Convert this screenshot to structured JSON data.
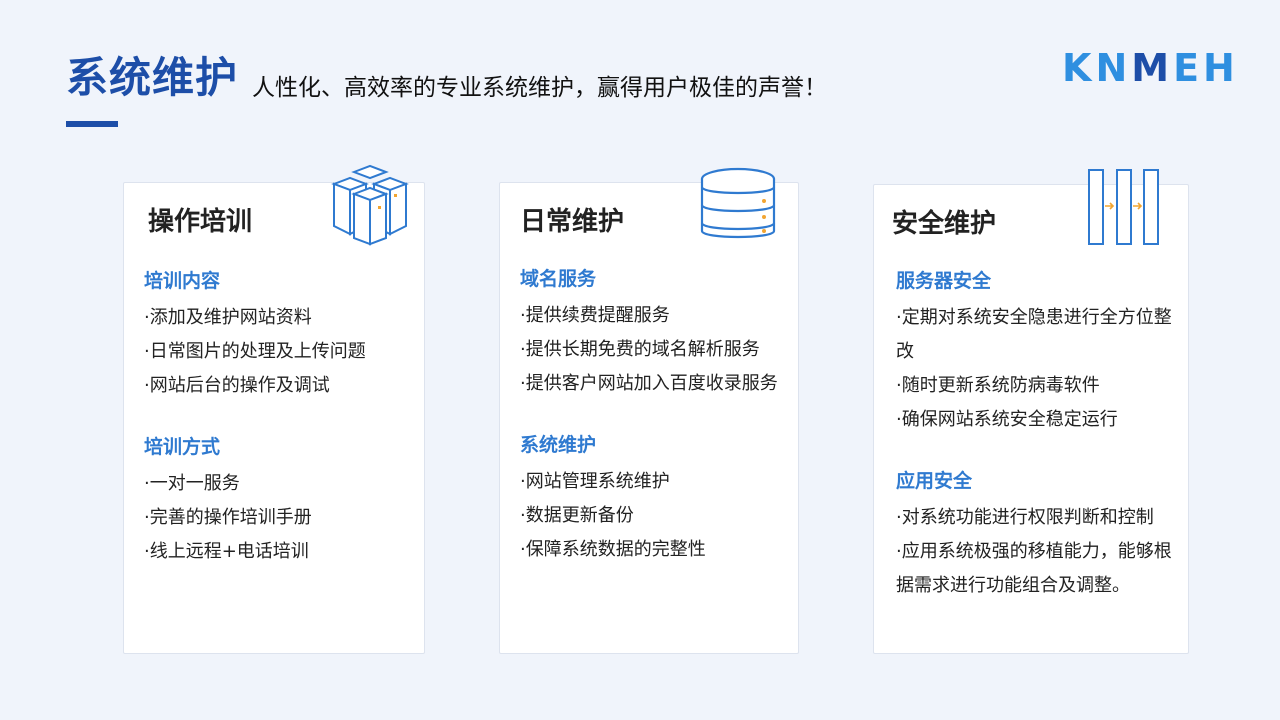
{
  "header": {
    "title": "系统维护",
    "subtitle": "人性化、高效率的专业系统维护，赢得用户极佳的声誉！",
    "logo": {
      "part1": "K",
      "part2": "N",
      "part3": "M",
      "part4": "EH"
    }
  },
  "cards": [
    {
      "title": "操作培训",
      "icon": "server-cluster-icon",
      "sections": [
        {
          "heading": "培训内容",
          "items": [
            "·添加及维护网站资料",
            "·日常图片的处理及上传问题",
            "·网站后台的操作及调试"
          ]
        },
        {
          "heading": "培训方式",
          "items": [
            "·一对一服务",
            "·完善的操作培训手册",
            "·线上远程+电话培训"
          ]
        }
      ]
    },
    {
      "title": "日常维护",
      "icon": "database-icon",
      "sections": [
        {
          "heading": "域名服务",
          "items": [
            "·提供续费提醒服务",
            "·提供长期免费的域名解析服务",
            "·提供客户网站加入百度收录服务"
          ]
        },
        {
          "heading": "系统维护",
          "items": [
            "·网站管理系统维护",
            "·数据更新备份",
            "·保障系统数据的完整性"
          ]
        }
      ]
    },
    {
      "title": "安全维护",
      "icon": "server-rack-icon",
      "sections": [
        {
          "heading": "服务器安全",
          "items": [
            "·定期对系统安全隐患进行全方位整改",
            "·随时更新系统防病毒软件",
            "·确保网站系统安全稳定运行"
          ]
        },
        {
          "heading": "应用安全",
          "items": [
            "·对系统功能进行权限判断和控制",
            "·应用系统极强的移植能力，能够根据需求进行功能组合及调整。"
          ]
        }
      ]
    }
  ],
  "colors": {
    "accent": "#1d4ea8",
    "section_heading": "#2f7ad0",
    "logo_light": "#2f8fe0"
  }
}
